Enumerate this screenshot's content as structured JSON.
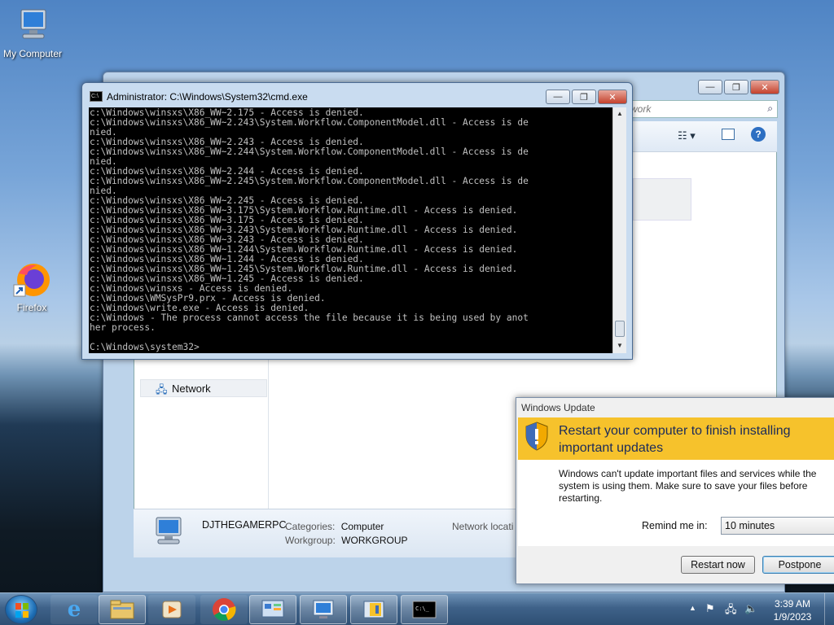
{
  "desktop": {
    "icons": [
      {
        "label": "My Computer"
      },
      {
        "label": "Firefox"
      }
    ]
  },
  "explorer": {
    "search_placeholder": "work",
    "nav_items": [
      {
        "label": "Network"
      }
    ],
    "details": {
      "computer_name": "DJTHEGAMERPC",
      "categories_label": "Categories:",
      "categories_value": "Computer",
      "workgroup_label": "Workgroup:",
      "workgroup_value": "WORKGROUP",
      "network_location_label": "Network locati"
    }
  },
  "cmd": {
    "title": "Administrator: C:\\Windows\\System32\\cmd.exe",
    "lines": [
      "c:\\Windows\\winsxs\\X86_WW~2.175 - Access is denied.",
      "c:\\Windows\\winsxs\\X86_WW~2.243\\System.Workflow.ComponentModel.dll - Access is de",
      "nied.",
      "c:\\Windows\\winsxs\\X86_WW~2.243 - Access is denied.",
      "c:\\Windows\\winsxs\\X86_WW~2.244\\System.Workflow.ComponentModel.dll - Access is de",
      "nied.",
      "c:\\Windows\\winsxs\\X86_WW~2.244 - Access is denied.",
      "c:\\Windows\\winsxs\\X86_WW~2.245\\System.Workflow.ComponentModel.dll - Access is de",
      "nied.",
      "c:\\Windows\\winsxs\\X86_WW~2.245 - Access is denied.",
      "c:\\Windows\\winsxs\\X86_WW~3.175\\System.Workflow.Runtime.dll - Access is denied.",
      "c:\\Windows\\winsxs\\X86_WW~3.175 - Access is denied.",
      "c:\\Windows\\winsxs\\X86_WW~3.243\\System.Workflow.Runtime.dll - Access is denied.",
      "c:\\Windows\\winsxs\\X86_WW~3.243 - Access is denied.",
      "c:\\Windows\\winsxs\\X86_WW~1.244\\System.Workflow.Runtime.dll - Access is denied.",
      "c:\\Windows\\winsxs\\X86_WW~1.244 - Access is denied.",
      "c:\\Windows\\winsxs\\X86_WW~1.245\\System.Workflow.Runtime.dll - Access is denied.",
      "c:\\Windows\\winsxs\\X86_WW~1.245 - Access is denied.",
      "c:\\Windows\\winsxs - Access is denied.",
      "c:\\Windows\\WMSysPr9.prx - Access is denied.",
      "c:\\Windows\\write.exe - Access is denied.",
      "c:\\Windows - The process cannot access the file because it is being used by anot",
      "her process."
    ],
    "prompt": "C:\\Windows\\system32>"
  },
  "windows_update": {
    "title": "Windows Update",
    "heading": "Restart your computer to finish installing important updates",
    "message": "Windows can't update important files and services while the system is using them. Make sure to save your files before restarting.",
    "remind_label": "Remind me in:",
    "remind_value": "10 minutes",
    "restart_label": "Restart now",
    "postpone_label": "Postpone"
  },
  "taskbar": {
    "time": "3:39 AM",
    "date": "1/9/2023"
  }
}
